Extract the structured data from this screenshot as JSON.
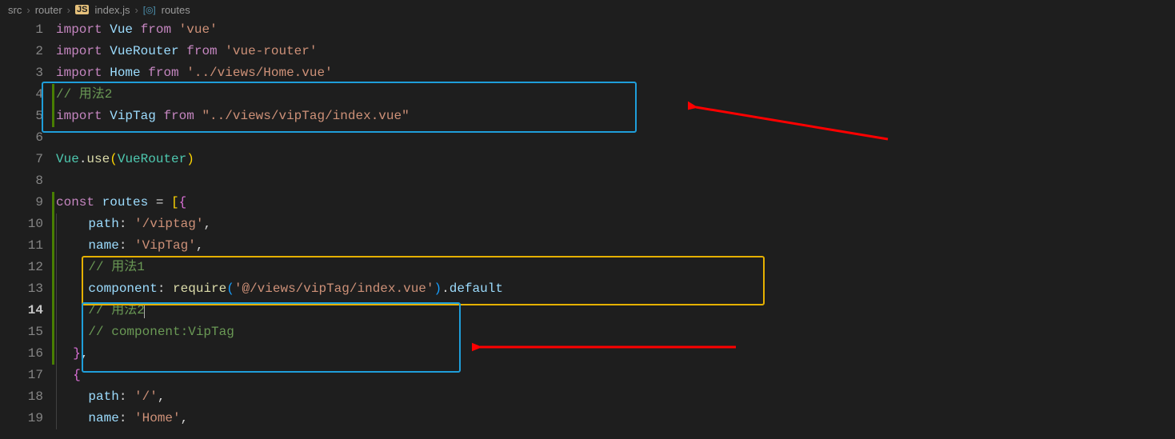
{
  "breadcrumbs": {
    "src": "src",
    "router": "router",
    "file": "index.js",
    "symbol": "routes"
  },
  "lines": {
    "l1": {
      "import": "import",
      "vue": "Vue",
      "from": "from",
      "str": "'vue'"
    },
    "l2": {
      "import": "import",
      "vr": "VueRouter",
      "from": "from",
      "str": "'vue-router'"
    },
    "l3": {
      "import": "import",
      "home": "Home",
      "from": "from",
      "str": "'../views/Home.vue'"
    },
    "l4": {
      "cmt": "// 用法2"
    },
    "l5": {
      "import": "import",
      "vt": "VipTag",
      "from": "from",
      "str": "\"../views/vipTag/index.vue\""
    },
    "l7": {
      "vue": "Vue",
      "use": "use",
      "vr": "VueRouter"
    },
    "l9": {
      "const": "const",
      "routes": "routes"
    },
    "l10": {
      "path": "path",
      "val": "'/viptag'"
    },
    "l11": {
      "name": "name",
      "val": "'VipTag'"
    },
    "l12": {
      "cmt": "// 用法1"
    },
    "l13": {
      "comp": "component",
      "req": "require",
      "str": "'@/views/vipTag/index.vue'",
      "def": "default"
    },
    "l14": {
      "cmt": "// 用法2"
    },
    "l15": {
      "cmt": "// component:VipTag"
    },
    "l17": {
      "brace": "{"
    },
    "l18": {
      "path": "path",
      "val": "'/'"
    },
    "l19": {
      "name": "name",
      "val": "'Home'"
    }
  },
  "gutter": [
    "1",
    "2",
    "3",
    "4",
    "5",
    "6",
    "7",
    "8",
    "9",
    "10",
    "11",
    "12",
    "13",
    "14",
    "15",
    "16",
    "17",
    "18",
    "19"
  ]
}
